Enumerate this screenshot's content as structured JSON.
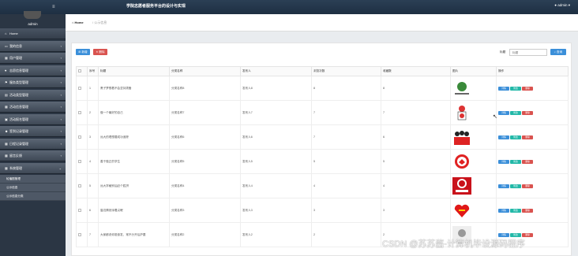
{
  "header": {
    "title": "学院志愿者服务平台的设计与实现",
    "user": "admin"
  },
  "sidebar": {
    "admin_name": "admin",
    "items": [
      {
        "label": "Home",
        "icon": "home-icon"
      },
      {
        "label": "我的信息",
        "icon": "id-card-icon"
      },
      {
        "label": "用户管理",
        "icon": "grid-icon"
      },
      {
        "label": "志愿信息管理",
        "icon": "heart-icon"
      },
      {
        "label": "服务类型管理",
        "icon": "flag-icon"
      },
      {
        "label": "活动类型管理",
        "icon": "calendar-icon"
      },
      {
        "label": "活动信息管理",
        "icon": "grid-icon"
      },
      {
        "label": "活动报名管理",
        "icon": "clipboard-icon"
      },
      {
        "label": "签到记录管理",
        "icon": "user-icon"
      },
      {
        "label": "日程记录管理",
        "icon": "grid-icon"
      },
      {
        "label": "留言反馈",
        "icon": "grid-icon"
      },
      {
        "label": "系统管理",
        "icon": "grid-icon"
      }
    ],
    "subitems": [
      "轮播图管理",
      "公示信息",
      "公示信息分类"
    ]
  },
  "breadcrumb": {
    "home": "Home",
    "current": "公示信息"
  },
  "toolbar": {
    "add": "新增",
    "delete": "删除",
    "search_label": "标题",
    "search_placeholder": "标题",
    "search": "查询"
  },
  "table": {
    "headers": [
      "",
      "序号",
      "标题",
      "分类名称",
      "发布人",
      "浏览次数",
      "收藏数",
      "图片",
      "操作"
    ],
    "rows": [
      {
        "idx": "1",
        "title": "黑子梦想着不会坚持拨备",
        "cat": "分类名称8",
        "pub": "发布人8",
        "views": "8",
        "fav": "8"
      },
      {
        "idx": "2",
        "title": "做一个最好的自己",
        "cat": "分类名称7",
        "pub": "发布人7",
        "views": "7",
        "fav": "7"
      },
      {
        "idx": "3",
        "title": "远大的理想要成功追踪",
        "cat": "分类名称6",
        "pub": "发布人6",
        "views": "7",
        "fav": "6"
      },
      {
        "idx": "4",
        "title": "善于做正的学生",
        "cat": "分类名称5",
        "pub": "发布人5",
        "views": "5",
        "fav": "5"
      },
      {
        "idx": "5",
        "title": "远大学格别后赶个胜拼",
        "cat": "分类名称4",
        "pub": "发布人4",
        "views": "4",
        "fav": "4"
      },
      {
        "idx": "6",
        "title": "窗边情然深着尖眠",
        "cat": "分类名称3",
        "pub": "发布人3",
        "views": "3",
        "fav": "3"
      },
      {
        "idx": "7",
        "title": "大家都说你挺奋发，常不分开后护要",
        "cat": "分类名称2",
        "pub": "发布人2",
        "views": "2",
        "fav": "2"
      }
    ],
    "ops": {
      "detail": "详情",
      "edit": "修改",
      "remove": "删除"
    }
  },
  "watermark": "CSDN @苏苏酱-计算机毕设源码程序",
  "colors": {
    "primary": "#3b8fd9",
    "danger": "#d9534f",
    "edit": "#22b8a8",
    "sidebar": "#2b3644"
  }
}
